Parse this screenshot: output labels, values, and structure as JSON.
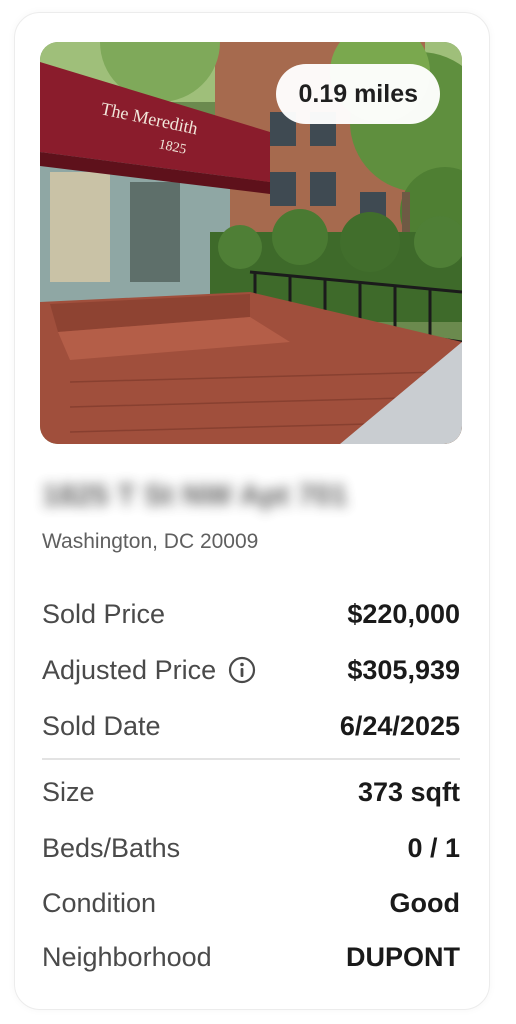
{
  "listing": {
    "distance_badge": "0.19 miles",
    "photo_sign": {
      "name": "The Meredith",
      "number": "1825"
    },
    "address_blurred": "1825 T St NW Apt 701",
    "city_state_zip": "Washington, DC 20009"
  },
  "price_rows": [
    {
      "label": "Sold Price",
      "value": "$220,000"
    },
    {
      "label": "Adjusted Price",
      "value": "$305,939",
      "icon": "info-icon"
    },
    {
      "label": "Sold Date",
      "value": "6/24/2025"
    }
  ],
  "detail_rows": [
    {
      "label": "Size",
      "value": "373 sqft"
    },
    {
      "label": "Beds/Baths",
      "value": "0 / 1"
    },
    {
      "label": "Condition",
      "value": "Good"
    },
    {
      "label": "Neighborhood",
      "value": "DUPONT"
    }
  ]
}
